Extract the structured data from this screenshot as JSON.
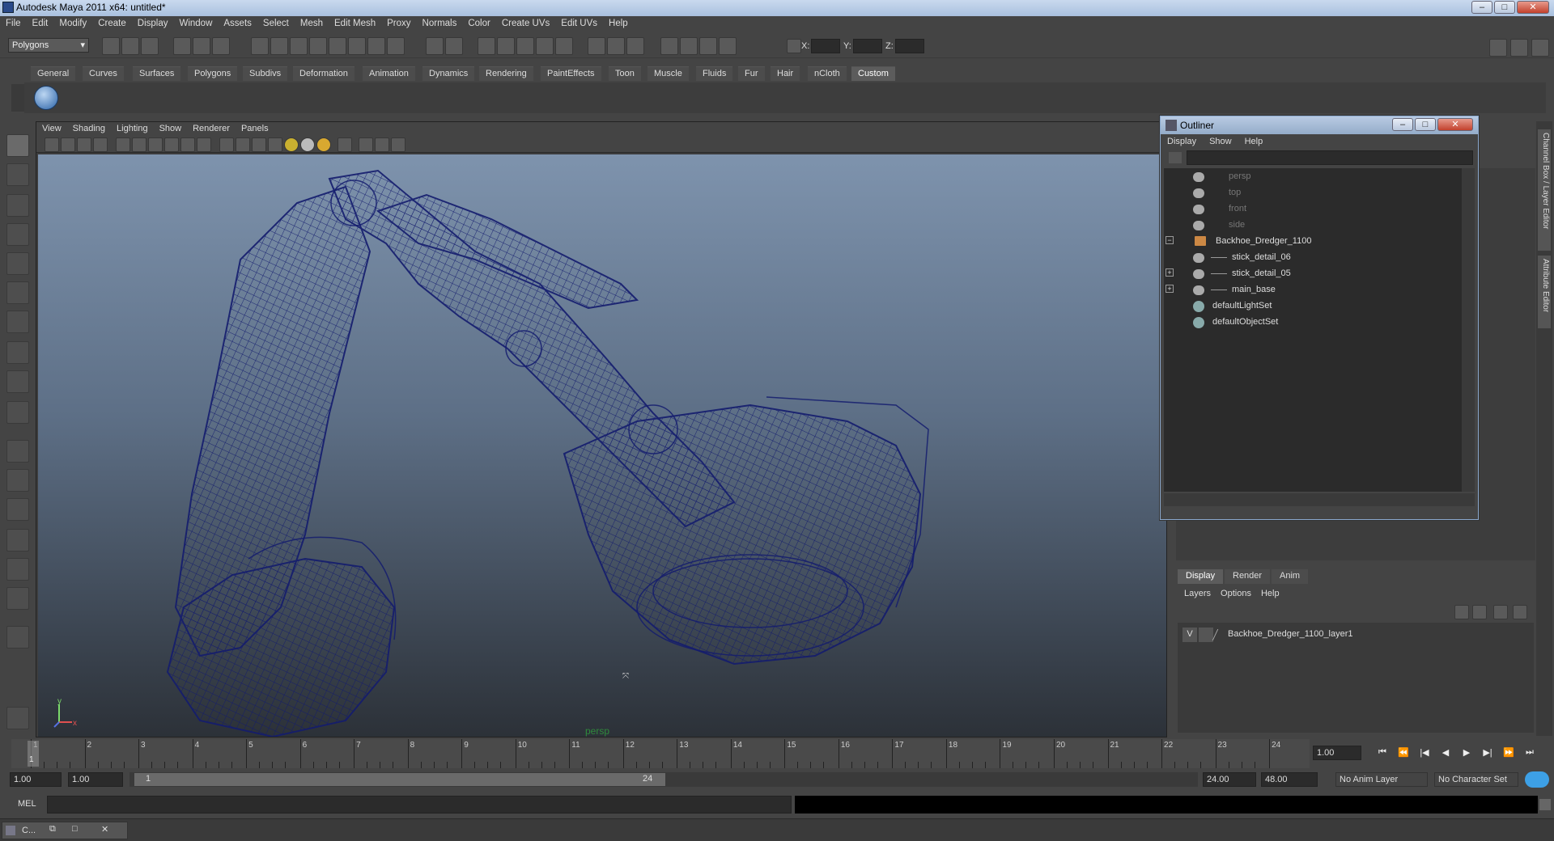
{
  "window": {
    "title": "Autodesk Maya 2011 x64: untitled*"
  },
  "menubar": [
    "File",
    "Edit",
    "Modify",
    "Create",
    "Display",
    "Window",
    "Assets",
    "Select",
    "Mesh",
    "Edit Mesh",
    "Proxy",
    "Normals",
    "Color",
    "Create UVs",
    "Edit UVs",
    "Help"
  ],
  "statusline": {
    "mode": "Polygons",
    "x_label": "X:",
    "y_label": "Y:",
    "z_label": "Z:"
  },
  "shelf_tabs": [
    "General",
    "Curves",
    "Surfaces",
    "Polygons",
    "Subdivs",
    "Deformation",
    "Animation",
    "Dynamics",
    "Rendering",
    "PaintEffects",
    "Toon",
    "Muscle",
    "Fluids",
    "Fur",
    "Hair",
    "nCloth",
    "Custom"
  ],
  "shelf_active": "Custom",
  "viewport": {
    "menu": [
      "View",
      "Shading",
      "Lighting",
      "Show",
      "Renderer",
      "Panels"
    ],
    "camera_label": "persp",
    "wire_color": "#141c6e"
  },
  "outliner": {
    "title": "Outliner",
    "menu": [
      "Display",
      "Show",
      "Help"
    ],
    "items": [
      {
        "label": "persp",
        "dim": true
      },
      {
        "label": "top",
        "dim": true
      },
      {
        "label": "front",
        "dim": true
      },
      {
        "label": "side",
        "dim": true
      },
      {
        "label": "Backhoe_Dredger_1100",
        "dim": false
      },
      {
        "label": "stick_detail_06",
        "dim": false
      },
      {
        "label": "stick_detail_05",
        "dim": false
      },
      {
        "label": "main_base",
        "dim": false
      },
      {
        "label": "defaultLightSet",
        "dim": false
      },
      {
        "label": "defaultObjectSet",
        "dim": false
      }
    ]
  },
  "sidetabs": [
    "Channel Box / Layer Editor",
    "Attribute Editor"
  ],
  "layer_editor": {
    "tabs": [
      "Display",
      "Render",
      "Anim"
    ],
    "menu": [
      "Layers",
      "Options",
      "Help"
    ],
    "layer_visible": "V",
    "layer_name": "Backhoe_Dredger_1100_layer1"
  },
  "timeline": {
    "ticks": [
      "1",
      "2",
      "3",
      "4",
      "5",
      "6",
      "7",
      "8",
      "9",
      "10",
      "11",
      "12",
      "13",
      "14",
      "15",
      "16",
      "17",
      "18",
      "19",
      "20",
      "21",
      "22",
      "23",
      "24"
    ],
    "current_frame": "1",
    "current_time_field": "1.00"
  },
  "range": {
    "start": "1.00",
    "start_inner": "1.00",
    "slider_start": "1",
    "slider_end": "24",
    "end_inner": "24.00",
    "end": "48.00",
    "anim_layer": "No Anim Layer",
    "character_set": "No Character Set"
  },
  "command_line": {
    "label": "MEL"
  },
  "taskbar": {
    "item": "C..."
  }
}
